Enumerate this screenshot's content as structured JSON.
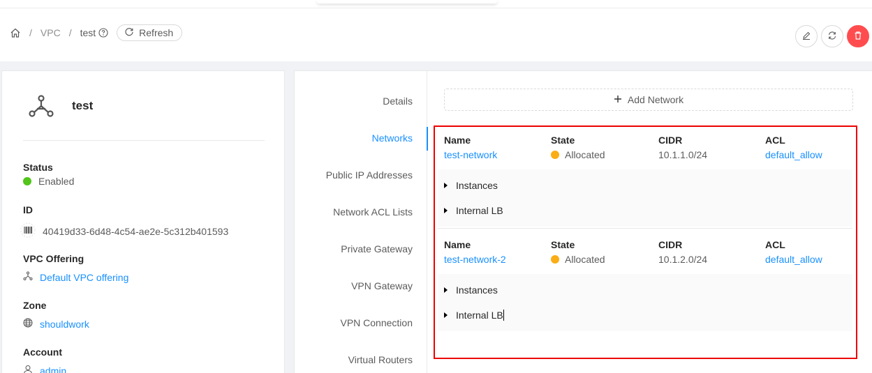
{
  "breadcrumb": {
    "items": [
      "VPC",
      "test"
    ],
    "separator": "/"
  },
  "header": {
    "refresh_label": "Refresh"
  },
  "vpc": {
    "name": "test",
    "fields": {
      "status_label": "Status",
      "status_value": "Enabled",
      "id_label": "ID",
      "id_value": "40419d33-6d48-4c54-ae2e-5c312b401593",
      "offering_label": "VPC Offering",
      "offering_value": "Default VPC offering",
      "zone_label": "Zone",
      "zone_value": "shouldwork",
      "account_label": "Account",
      "account_value": "admin"
    }
  },
  "tabs": [
    {
      "label": "Details"
    },
    {
      "label": "Networks"
    },
    {
      "label": "Public IP Addresses"
    },
    {
      "label": "Network ACL Lists"
    },
    {
      "label": "Private Gateway"
    },
    {
      "label": "VPN Gateway"
    },
    {
      "label": "VPN Connection"
    },
    {
      "label": "Virtual Routers"
    }
  ],
  "active_tab": "Networks",
  "add_network_label": "Add Network",
  "columns": {
    "name": "Name",
    "state": "State",
    "cidr": "CIDR",
    "acl": "ACL"
  },
  "networks": [
    {
      "name": "test-network",
      "state": "Allocated",
      "cidr": "10.1.1.0/24",
      "acl": "default_allow",
      "sections": [
        "Instances",
        "Internal LB"
      ]
    },
    {
      "name": "test-network-2",
      "state": "Allocated",
      "cidr": "10.1.2.0/24",
      "acl": "default_allow",
      "sections": [
        "Instances",
        "Internal LB"
      ]
    }
  ],
  "colors": {
    "accent": "#1890ff",
    "enabled": "#52c41a",
    "allocated": "#faad14",
    "danger": "#ff4d4f",
    "highlight": "#ee0000"
  },
  "icons": {
    "home": "home-icon",
    "help": "question-circle-icon",
    "refresh": "reload-icon",
    "edit": "edit-icon",
    "sync": "sync-icon",
    "delete": "delete-icon",
    "vpc": "deployment-unit-icon",
    "id": "barcode-icon",
    "zone": "global-icon",
    "account": "user-icon",
    "add": "plus-icon",
    "caret": "caret-right-icon"
  }
}
